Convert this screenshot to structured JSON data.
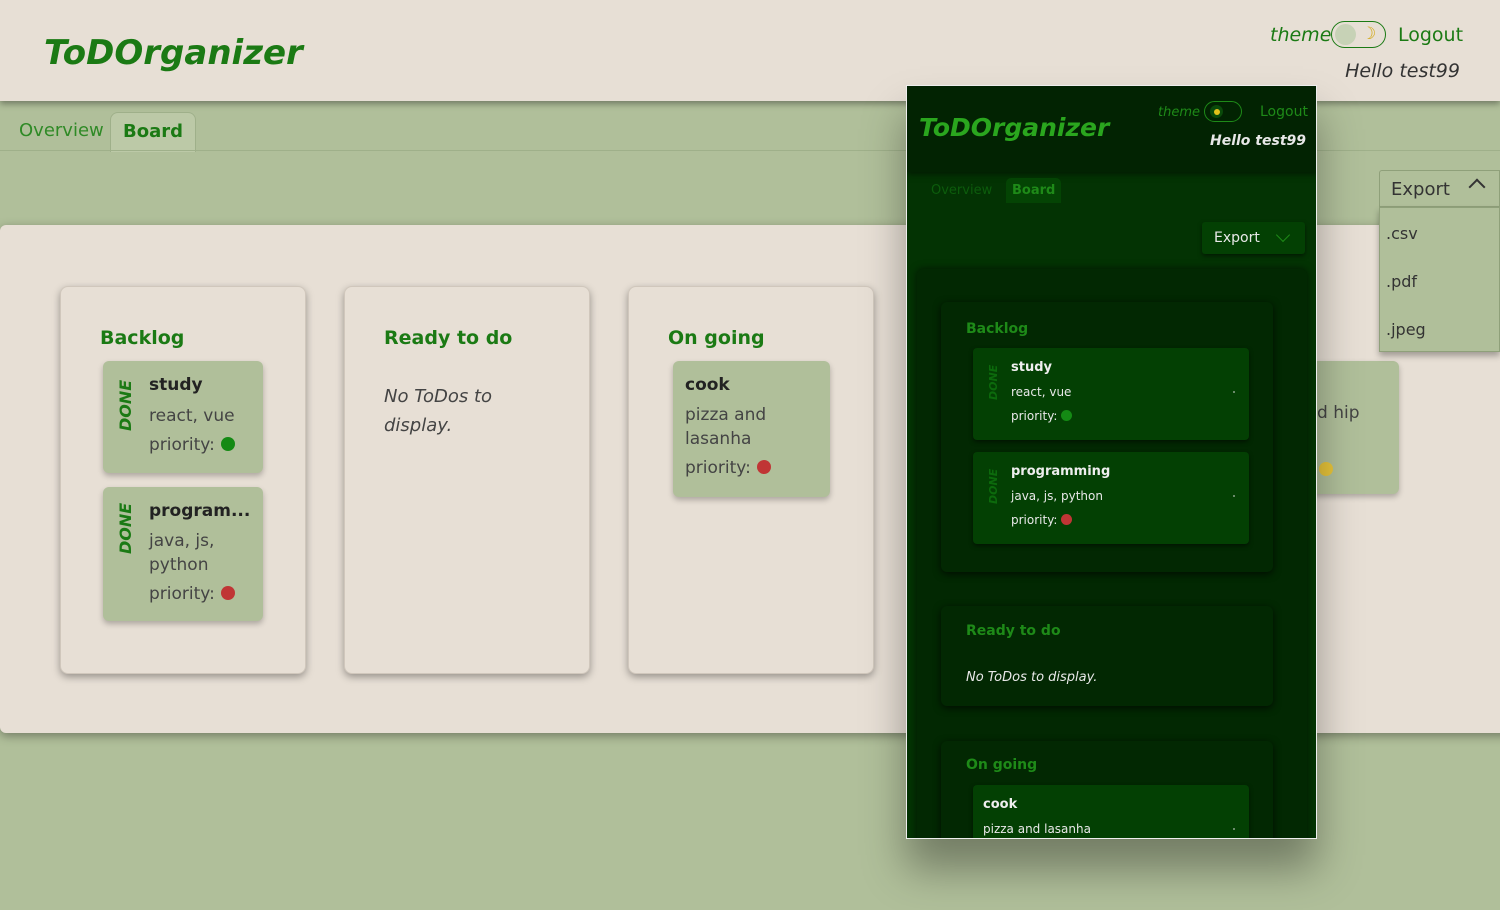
{
  "header": {
    "logo": "ToDOrganizer",
    "theme_label": "theme",
    "logout_label": "Logout",
    "greeting": "Hello test99"
  },
  "tabs": [
    {
      "label": "Overview",
      "active": false
    },
    {
      "label": "Board",
      "active": true
    }
  ],
  "export": {
    "label": "Export",
    "options": [
      ".csv",
      ".pdf",
      ".jpeg"
    ]
  },
  "board": {
    "columns": [
      {
        "title": "Backlog",
        "cards": [
          {
            "status": "DONE",
            "title": "study",
            "description": "react, vue",
            "priority_label": "priority:",
            "priority_color": "#148a14"
          },
          {
            "status": "DONE",
            "title": "program...",
            "description": "java, js, python",
            "priority_label": "priority:",
            "priority_color": "#c03535"
          }
        ]
      },
      {
        "title": "Ready to do",
        "empty_message": "No ToDos to display."
      },
      {
        "title": "On going",
        "cards": [
          {
            "title": "cook",
            "description": "pizza and lasanha",
            "priority_label": "priority:",
            "priority_color": "#c03535"
          }
        ]
      }
    ],
    "partial_card": {
      "text": "d hip",
      "priority_color": "#e8c53a"
    }
  },
  "dark_preview": {
    "logo": "ToDOrganizer",
    "theme_label": "theme",
    "logout_label": "Logout",
    "greeting": "Hello test99",
    "tabs": [
      {
        "label": "Overview"
      },
      {
        "label": "Board"
      }
    ],
    "export_label": "Export",
    "columns": [
      {
        "title": "Backlog",
        "cards": [
          {
            "status": "DONE",
            "title": "study",
            "description": "react, vue",
            "priority_label": "priority:",
            "priority_color": "#148a14"
          },
          {
            "status": "DONE",
            "title": "programming",
            "description": "java, js, python",
            "priority_label": "priority:",
            "priority_color": "#c03535"
          }
        ]
      },
      {
        "title": "Ready to do",
        "empty_message": "No ToDos to display."
      },
      {
        "title": "On going",
        "cards": [
          {
            "title": "cook",
            "description": "pizza and lasanha"
          }
        ]
      }
    ]
  },
  "colors": {
    "brand_green": "#1b7a14",
    "page_bg": "#b0bf9a",
    "panel_bg": "#e7dfd5",
    "dark_bg": "#033303"
  }
}
